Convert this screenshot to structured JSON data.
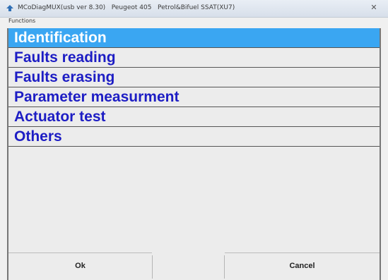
{
  "window": {
    "title": "MCoDiagMUX(usb ver 8.30)   Peugeot 405   Petrol&Bifuel SSAT(XU7)",
    "close_label": "✕",
    "group_label": "Functions"
  },
  "menu": {
    "selected_index": 0,
    "items": [
      {
        "label": "Identification"
      },
      {
        "label": "Faults reading"
      },
      {
        "label": "Faults erasing"
      },
      {
        "label": "Parameter measurment"
      },
      {
        "label": "Actuator test"
      },
      {
        "label": "Others"
      }
    ]
  },
  "buttons": {
    "ok_label": "Ok",
    "cancel_label": "Cancel"
  },
  "colors": {
    "selected_bg": "#3aa6f2",
    "item_text": "#1d1dc4"
  }
}
